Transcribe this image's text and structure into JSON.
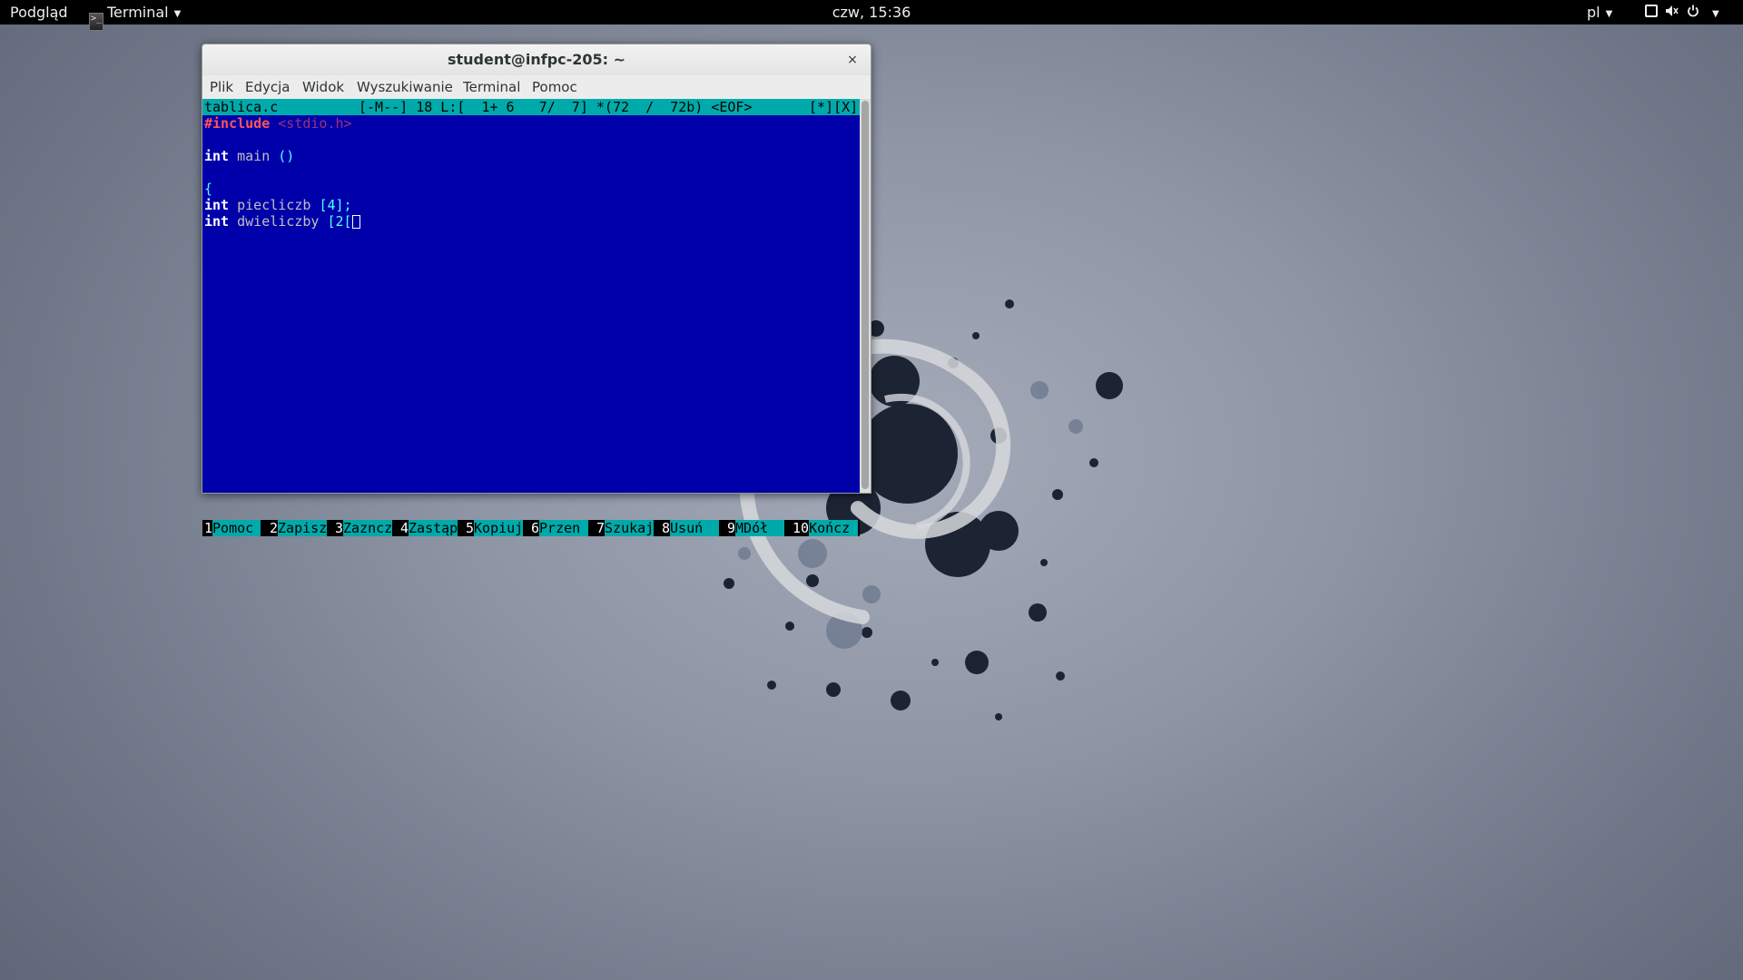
{
  "topbar": {
    "activities": "Podgląd",
    "app_name": "Terminal",
    "clock": "czw, 15:36",
    "lang": "pl",
    "icons": [
      "screen-icon",
      "volume-icon",
      "power-icon"
    ]
  },
  "window": {
    "title": "student@infpc-205: ~",
    "close": "×",
    "menu": [
      "Plik",
      "Edycja",
      "Widok",
      "Wyszukiwanie",
      "Terminal",
      "Pomoc"
    ]
  },
  "editor": {
    "filename": "tablica.c",
    "status": "[-M--] 18 L:[  1+ 6   7/  7] *(72  /  72b) <EOF>",
    "flags": "[*][X]",
    "lines": [
      {
        "a": "#include",
        "b": " <stdio.h>"
      },
      {
        "a": "",
        "b": ""
      },
      {
        "a": "int",
        "b": " main ",
        "c": "()"
      },
      {
        "a": "",
        "b": ""
      },
      {
        "a": "{",
        "b": ""
      },
      {
        "a": "int",
        "b": " piecliczb ",
        "c": "[4];"
      },
      {
        "a": "int",
        "b": " dwieliczby ",
        "c": "[2["
      }
    ],
    "fkeys": [
      {
        "num": "1",
        "label": "Pomoc"
      },
      {
        "num": "2",
        "label": "Zapisz"
      },
      {
        "num": "3",
        "label": "Zazncz"
      },
      {
        "num": "4",
        "label": "Zastąp"
      },
      {
        "num": "5",
        "label": "Kopiuj"
      },
      {
        "num": "6",
        "label": "Przen"
      },
      {
        "num": "7",
        "label": "Szukaj"
      },
      {
        "num": "8",
        "label": "Usuń"
      },
      {
        "num": "9",
        "label": "MDół"
      },
      {
        "num": "10",
        "label": "Kończ"
      }
    ]
  },
  "colors": {
    "editor_bg": "#0000aa",
    "status_bg": "#00aaaa",
    "topbar_bg": "#000000"
  }
}
